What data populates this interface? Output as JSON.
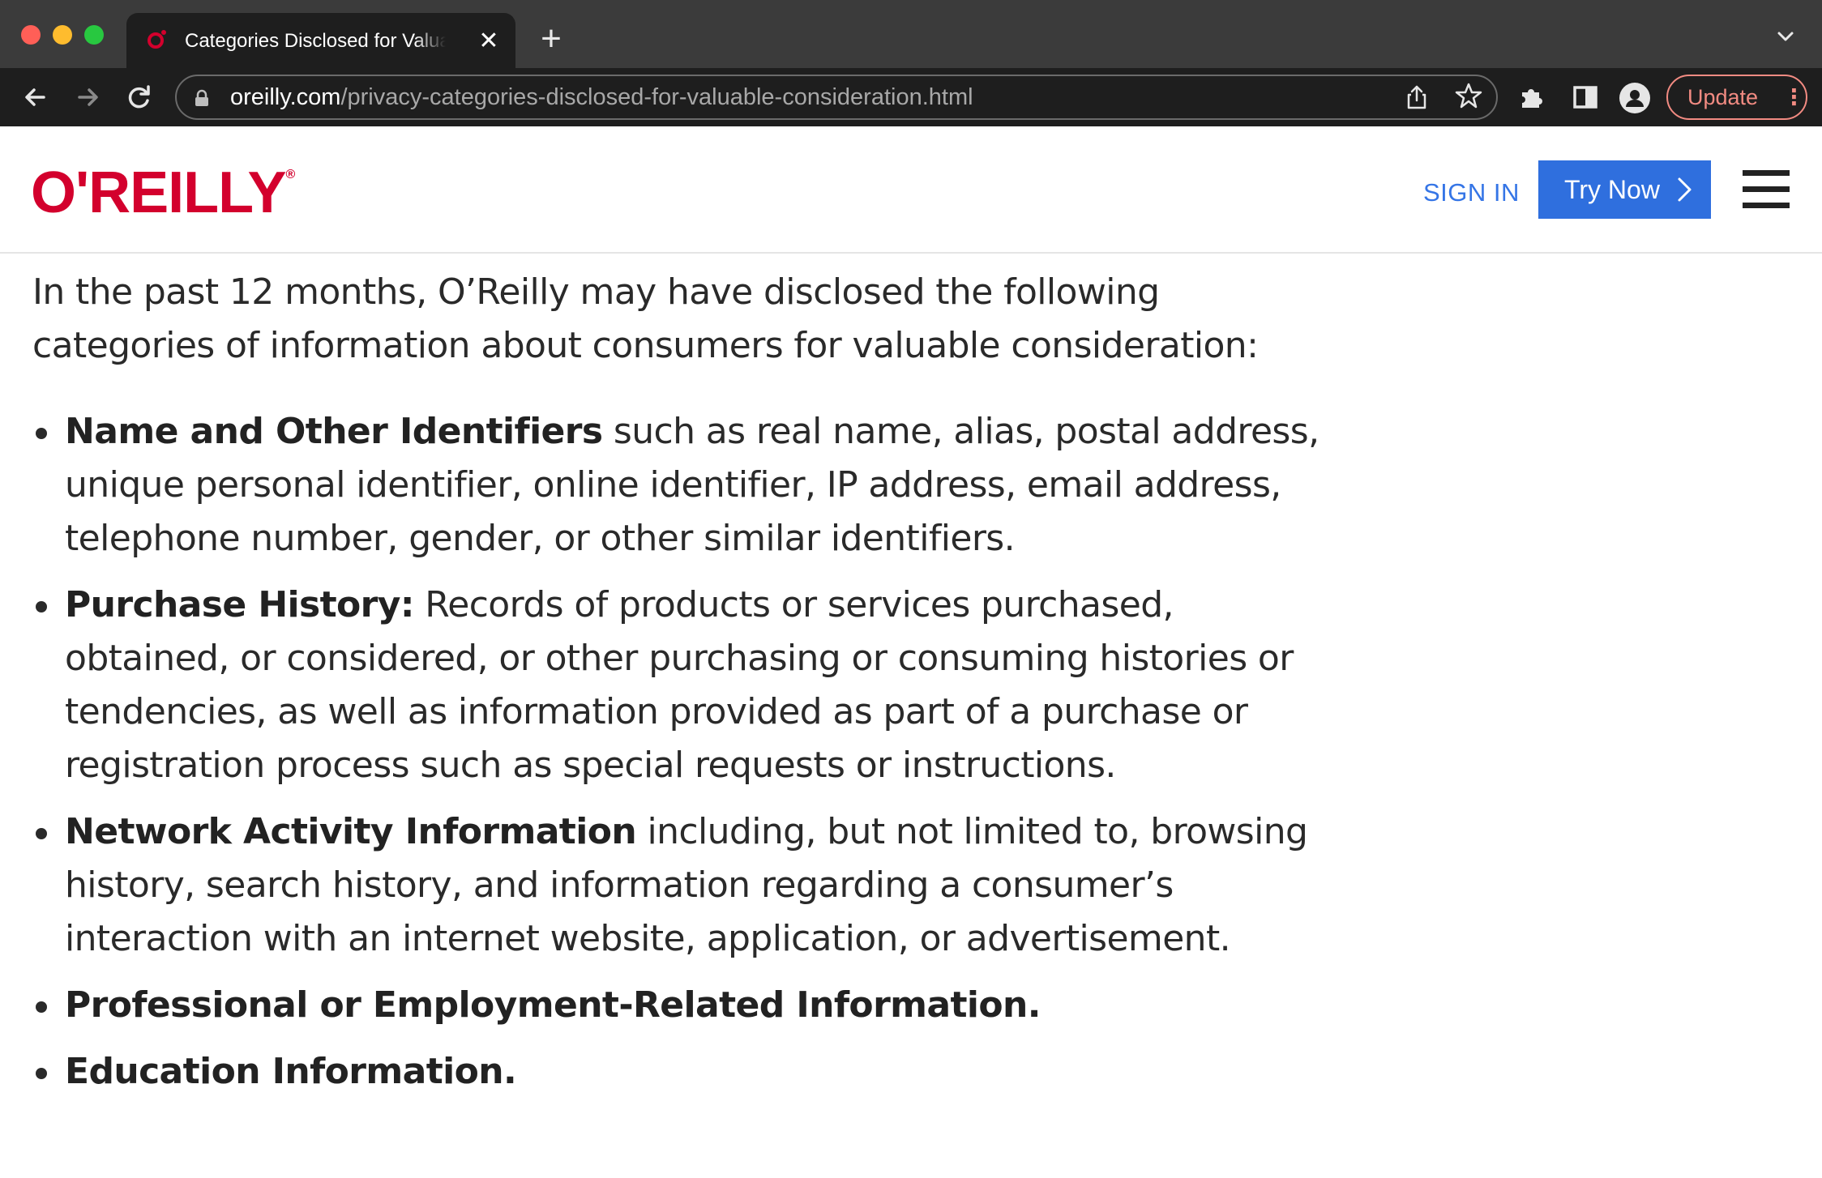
{
  "browser": {
    "tab_title": "Categories Disclosed for Valuable Consideration",
    "tab_close": "✕",
    "new_tab": "+",
    "url_host": "oreilly.com",
    "url_path": "/privacy-categories-disclosed-for-valuable-consideration.html",
    "update_label": "Update",
    "icons": [
      "back-icon",
      "forward-icon",
      "reload-icon",
      "lock-icon",
      "share-icon",
      "star-icon",
      "extensions-icon",
      "side-panel-icon",
      "profile-icon",
      "more-icon",
      "tab-list-icon"
    ]
  },
  "header": {
    "logo": "O'REILLY",
    "sign_in": "SIGN IN",
    "try_now": "Try Now",
    "brand_color": "#d3002d",
    "accent_color": "#2f6fde"
  },
  "content": {
    "intro": "In the past 12 months, O’Reilly may have disclosed the following categories of information about consumers for valuable consideration:",
    "items": [
      {
        "title": "Name and Other Identifiers",
        "text": " such as real name, alias, postal address, unique personal identifier, online identifier, IP address, email address, telephone number, gender, or other similar identifiers."
      },
      {
        "title": "Purchase History:",
        "text": " Records of products or services purchased, obtained, or considered, or other purchasing or consuming histories or tendencies, as well as information provided as part of a purchase or registration process such as special requests or instructions."
      },
      {
        "title": "Network Activity Information",
        "text": " including, but not limited to, browsing history, search history, and information regarding a consumer’s interaction with an internet website, application, or advertisement."
      },
      {
        "title": "Professional or Employment-Related Information.",
        "text": ""
      },
      {
        "title": "Education Information.",
        "text": ""
      }
    ]
  }
}
